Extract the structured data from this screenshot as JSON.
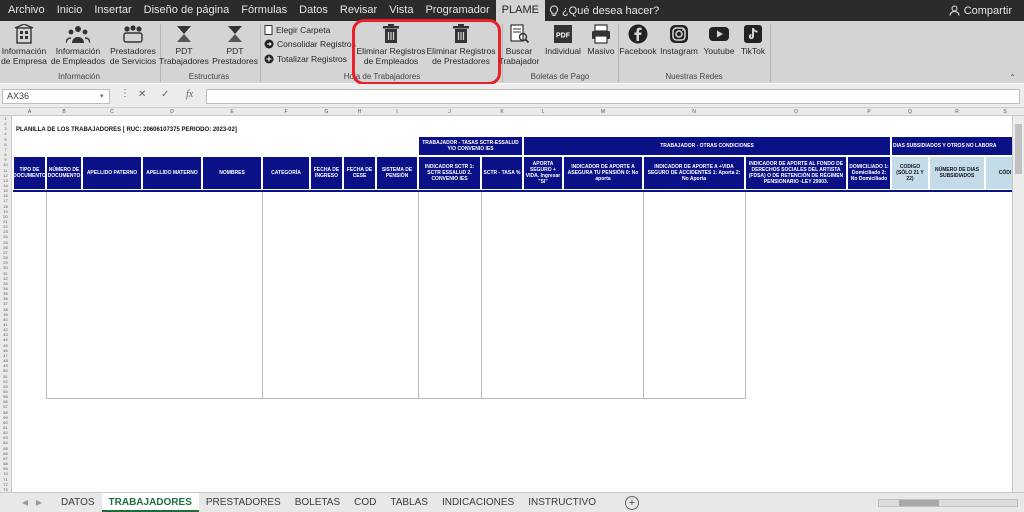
{
  "menu": {
    "items": [
      "Archivo",
      "Inicio",
      "Insertar",
      "Diseño de página",
      "Fórmulas",
      "Datos",
      "Revisar",
      "Vista",
      "Programador",
      "PLAME"
    ],
    "active": "PLAME",
    "help": "¿Qué desea hacer?",
    "share": "Compartir"
  },
  "ribbon": {
    "buttons": {
      "info_empresa": "Información de Empresa",
      "info_empleados": "Información de Empleados",
      "prestadores": "Prestadores de Servicios",
      "pdt_trab": "PDT Trabajadores",
      "pdt_prest": "PDT Prestadores",
      "elegir": "Elegir Carpeta",
      "consolidar": "Consolidar Registros",
      "totalizar": "Totalizar Registros",
      "elim_emp": "Eliminar Registros de Empleados",
      "elim_prest": "Eliminar Registros de Prestadores",
      "buscar": "Buscar Trabajador",
      "individual": "Individual",
      "masivo": "Masivo",
      "facebook": "Facebook",
      "instagram": "Instagram",
      "youtube": "Youtube",
      "tiktok": "TikTok"
    },
    "groups": {
      "informacion": "Información",
      "estructuras": "Estructuras",
      "hoja": "Hoja de Trabajadores",
      "boletas": "Boletas de Pago",
      "redes": "Nuestras Redes"
    },
    "icons": {
      "pdf": "PDF"
    }
  },
  "formula": {
    "namebox": "AX36",
    "fx": "fx",
    "value": ""
  },
  "columns": [
    "A",
    "B",
    "C",
    "D",
    "E",
    "F",
    "G",
    "H",
    "I",
    "J",
    "K",
    "L",
    "M",
    "N",
    "O",
    "P",
    "Q",
    "R",
    "S"
  ],
  "rows": [
    "1",
    "2",
    "3",
    "4",
    "5",
    "6",
    "7",
    "8",
    "9",
    "10",
    "11",
    "12",
    "13",
    "14",
    "15",
    "16",
    "17",
    "18",
    "19",
    "20",
    "21",
    "22",
    "23",
    "24",
    "25",
    "26",
    "27",
    "28",
    "29",
    "30",
    "31",
    "32",
    "33",
    "34",
    "35",
    "36",
    "37",
    "38",
    "39",
    "40",
    "41",
    "42",
    "43",
    "44",
    "45",
    "46",
    "47",
    "48",
    "49",
    "50",
    "51",
    "52",
    "53",
    "54",
    "55",
    "56",
    "57",
    "58",
    "59",
    "60",
    "61",
    "62",
    "63",
    "64",
    "65",
    "66",
    "67",
    "68",
    "69",
    "70",
    "71",
    "72",
    "73"
  ],
  "sheet": {
    "title": "PLANILLA DE LOS TRABAJADORES [ RUC: 20606107375  PERIODO: 2023-02]",
    "group_tasas": "TRABAJADOR - TASAS SCTR-ESSALUD Y/O CONVENIO IES",
    "group_otras": "TRABAJADOR - OTRAS CONDICIONES",
    "group_dias": "DIAS SUBSIDIADOS Y OTROS NO LABORA",
    "headers": {
      "tipo_doc": "TIPO DE DOCUMENTO",
      "num_doc": "NÚMERO DE DOCUMENTO",
      "ap_paterno": "APELLIDO PATERNO",
      "ap_materno": "APELLIDO MATERNO",
      "nombres": "NOMBRES",
      "categoria": "CATEGORÍA",
      "fecha_ingreso": "FECHA DE INGRESO",
      "fecha_cese": "FECHA DE CESE",
      "sistema_pension": "SISTEMA DE PENSIÓN",
      "indicador_sctr": "INDICADOR SCTR 1: SCTR ESSALUD 2. CONVENIO IES",
      "sctr_tasa": "SCTR - TASA %",
      "aporta_seguro": "APORTA SEGURO + VIDA. Ingresar \"SI\"",
      "indicador_aporte": "INDICADOR DE APORTE A ASEGURA TU PENSIÓN 0: No aporta",
      "indicador_vida": "INDICADOR DE APORTE A +VIDA SEGURO DE ACCIDENTES 1: Aporta 2: No Aporta",
      "indicador_fdsa": "INDICADOR DE APORTE AL FONDO DE DERECHOS SOCIALES DEL ARTISTA (FDSA) O DE RETENCIÓN DE RÉGIMEN PENSIONARIO -LEY 29903.",
      "domiciliado": "DOMICILIADO 1: Domiciliado 2: No Domiciliado",
      "codigo": "CODIGO (SÓLO 21 Y 22)",
      "num_dias": "NÚMERO DE DIAS SUBSIDIADOS",
      "codigo2": "CÓDI"
    }
  },
  "tabs": [
    "DATOS",
    "TRABAJADORES",
    "PRESTADORES",
    "BOLETAS",
    "COD",
    "TABLAS",
    "INDICACIONES",
    "INSTRUCTIVO"
  ],
  "active_tab": "TRABAJADORES"
}
